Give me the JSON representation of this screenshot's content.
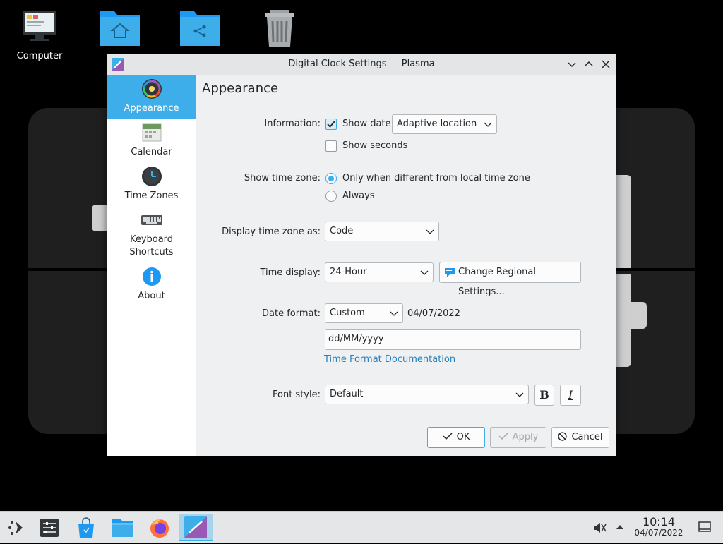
{
  "desktop": {
    "icons": [
      {
        "label": "Computer",
        "icon": "computer-icon"
      },
      {
        "label": "",
        "icon": "home-folder-icon"
      },
      {
        "label": "",
        "icon": "network-folder-icon"
      },
      {
        "label": "",
        "icon": "trash-icon"
      }
    ]
  },
  "window": {
    "title": "Digital Clock Settings — Plasma"
  },
  "sidebar": {
    "items": [
      {
        "label": "Appearance",
        "icon": "palette-icon",
        "active": true
      },
      {
        "label": "Calendar",
        "icon": "calendar-icon"
      },
      {
        "label": "Time Zones",
        "icon": "clock-icon"
      },
      {
        "label": "Keyboard Shortcuts",
        "icon": "keyboard-icon"
      },
      {
        "label": "About",
        "icon": "info-icon"
      }
    ]
  },
  "page": {
    "title": "Appearance",
    "information": {
      "label": "Information:",
      "show_date_label": "Show date",
      "show_date_checked": true,
      "date_location": "Adaptive location",
      "show_seconds_label": "Show seconds",
      "show_seconds_checked": false
    },
    "timezone": {
      "label": "Show time zone:",
      "options": [
        "Only when different from local time zone",
        "Always"
      ],
      "selected": 0
    },
    "timezone_display": {
      "label": "Display time zone as:",
      "value": "Code"
    },
    "time_display": {
      "label": "Time display:",
      "value": "24-Hour",
      "regional_button": "Change Regional Settings..."
    },
    "date_format": {
      "label": "Date format:",
      "value": "Custom",
      "preview": "04/07/2022",
      "custom_input": "dd/MM/yyyy",
      "doc_link": "Time Format Documentation"
    },
    "font_style": {
      "label": "Font style:",
      "value": "Default",
      "bold": "B",
      "italic": "I"
    }
  },
  "buttons": {
    "ok": "OK",
    "apply": "Apply",
    "cancel": "Cancel"
  },
  "taskbar": {
    "time": "10:14",
    "date": "04/07/2022"
  },
  "colors": {
    "accent": "#3daee9",
    "link": "#2980b9"
  }
}
